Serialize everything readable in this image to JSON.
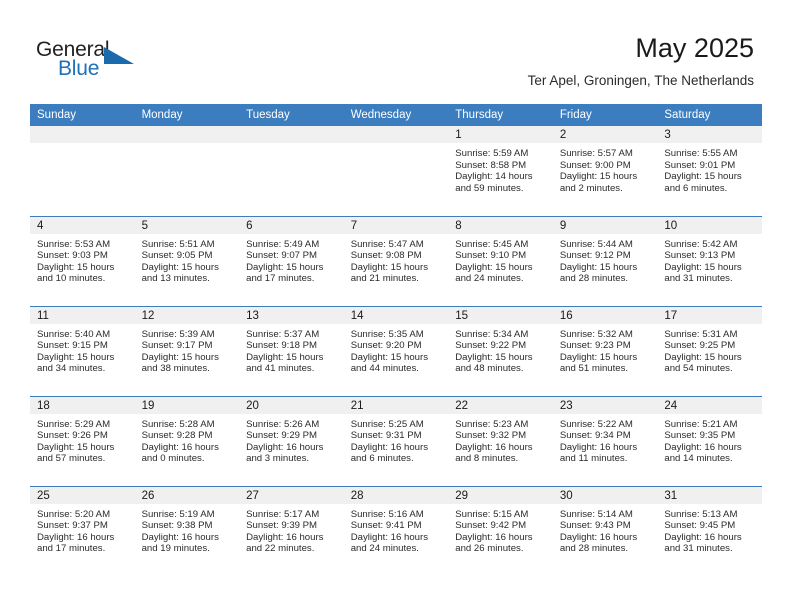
{
  "logo": {
    "word1": "General",
    "word2": "Blue",
    "triangle_color": "#1b6aad",
    "blue_color": "#1d72b8"
  },
  "header": {
    "title": "May 2025",
    "subtitle": "Ter Apel, Groningen, The Netherlands"
  },
  "theme": {
    "header_blue": "#3b7dbf",
    "daynum_bg": "#f0f0f0",
    "text": "#2b2b2b"
  },
  "calendar": {
    "weekday_headers": [
      "Sunday",
      "Monday",
      "Tuesday",
      "Wednesday",
      "Thursday",
      "Friday",
      "Saturday"
    ],
    "weeks": [
      [
        {
          "day": "",
          "sunrise": "",
          "sunset": "",
          "daylight1": "",
          "daylight2": ""
        },
        {
          "day": "",
          "sunrise": "",
          "sunset": "",
          "daylight1": "",
          "daylight2": ""
        },
        {
          "day": "",
          "sunrise": "",
          "sunset": "",
          "daylight1": "",
          "daylight2": ""
        },
        {
          "day": "",
          "sunrise": "",
          "sunset": "",
          "daylight1": "",
          "daylight2": ""
        },
        {
          "day": "1",
          "sunrise": "Sunrise: 5:59 AM",
          "sunset": "Sunset: 8:58 PM",
          "daylight1": "Daylight: 14 hours",
          "daylight2": "and 59 minutes."
        },
        {
          "day": "2",
          "sunrise": "Sunrise: 5:57 AM",
          "sunset": "Sunset: 9:00 PM",
          "daylight1": "Daylight: 15 hours",
          "daylight2": "and 2 minutes."
        },
        {
          "day": "3",
          "sunrise": "Sunrise: 5:55 AM",
          "sunset": "Sunset: 9:01 PM",
          "daylight1": "Daylight: 15 hours",
          "daylight2": "and 6 minutes."
        }
      ],
      [
        {
          "day": "4",
          "sunrise": "Sunrise: 5:53 AM",
          "sunset": "Sunset: 9:03 PM",
          "daylight1": "Daylight: 15 hours",
          "daylight2": "and 10 minutes."
        },
        {
          "day": "5",
          "sunrise": "Sunrise: 5:51 AM",
          "sunset": "Sunset: 9:05 PM",
          "daylight1": "Daylight: 15 hours",
          "daylight2": "and 13 minutes."
        },
        {
          "day": "6",
          "sunrise": "Sunrise: 5:49 AM",
          "sunset": "Sunset: 9:07 PM",
          "daylight1": "Daylight: 15 hours",
          "daylight2": "and 17 minutes."
        },
        {
          "day": "7",
          "sunrise": "Sunrise: 5:47 AM",
          "sunset": "Sunset: 9:08 PM",
          "daylight1": "Daylight: 15 hours",
          "daylight2": "and 21 minutes."
        },
        {
          "day": "8",
          "sunrise": "Sunrise: 5:45 AM",
          "sunset": "Sunset: 9:10 PM",
          "daylight1": "Daylight: 15 hours",
          "daylight2": "and 24 minutes."
        },
        {
          "day": "9",
          "sunrise": "Sunrise: 5:44 AM",
          "sunset": "Sunset: 9:12 PM",
          "daylight1": "Daylight: 15 hours",
          "daylight2": "and 28 minutes."
        },
        {
          "day": "10",
          "sunrise": "Sunrise: 5:42 AM",
          "sunset": "Sunset: 9:13 PM",
          "daylight1": "Daylight: 15 hours",
          "daylight2": "and 31 minutes."
        }
      ],
      [
        {
          "day": "11",
          "sunrise": "Sunrise: 5:40 AM",
          "sunset": "Sunset: 9:15 PM",
          "daylight1": "Daylight: 15 hours",
          "daylight2": "and 34 minutes."
        },
        {
          "day": "12",
          "sunrise": "Sunrise: 5:39 AM",
          "sunset": "Sunset: 9:17 PM",
          "daylight1": "Daylight: 15 hours",
          "daylight2": "and 38 minutes."
        },
        {
          "day": "13",
          "sunrise": "Sunrise: 5:37 AM",
          "sunset": "Sunset: 9:18 PM",
          "daylight1": "Daylight: 15 hours",
          "daylight2": "and 41 minutes."
        },
        {
          "day": "14",
          "sunrise": "Sunrise: 5:35 AM",
          "sunset": "Sunset: 9:20 PM",
          "daylight1": "Daylight: 15 hours",
          "daylight2": "and 44 minutes."
        },
        {
          "day": "15",
          "sunrise": "Sunrise: 5:34 AM",
          "sunset": "Sunset: 9:22 PM",
          "daylight1": "Daylight: 15 hours",
          "daylight2": "and 48 minutes."
        },
        {
          "day": "16",
          "sunrise": "Sunrise: 5:32 AM",
          "sunset": "Sunset: 9:23 PM",
          "daylight1": "Daylight: 15 hours",
          "daylight2": "and 51 minutes."
        },
        {
          "day": "17",
          "sunrise": "Sunrise: 5:31 AM",
          "sunset": "Sunset: 9:25 PM",
          "daylight1": "Daylight: 15 hours",
          "daylight2": "and 54 minutes."
        }
      ],
      [
        {
          "day": "18",
          "sunrise": "Sunrise: 5:29 AM",
          "sunset": "Sunset: 9:26 PM",
          "daylight1": "Daylight: 15 hours",
          "daylight2": "and 57 minutes."
        },
        {
          "day": "19",
          "sunrise": "Sunrise: 5:28 AM",
          "sunset": "Sunset: 9:28 PM",
          "daylight1": "Daylight: 16 hours",
          "daylight2": "and 0 minutes."
        },
        {
          "day": "20",
          "sunrise": "Sunrise: 5:26 AM",
          "sunset": "Sunset: 9:29 PM",
          "daylight1": "Daylight: 16 hours",
          "daylight2": "and 3 minutes."
        },
        {
          "day": "21",
          "sunrise": "Sunrise: 5:25 AM",
          "sunset": "Sunset: 9:31 PM",
          "daylight1": "Daylight: 16 hours",
          "daylight2": "and 6 minutes."
        },
        {
          "day": "22",
          "sunrise": "Sunrise: 5:23 AM",
          "sunset": "Sunset: 9:32 PM",
          "daylight1": "Daylight: 16 hours",
          "daylight2": "and 8 minutes."
        },
        {
          "day": "23",
          "sunrise": "Sunrise: 5:22 AM",
          "sunset": "Sunset: 9:34 PM",
          "daylight1": "Daylight: 16 hours",
          "daylight2": "and 11 minutes."
        },
        {
          "day": "24",
          "sunrise": "Sunrise: 5:21 AM",
          "sunset": "Sunset: 9:35 PM",
          "daylight1": "Daylight: 16 hours",
          "daylight2": "and 14 minutes."
        }
      ],
      [
        {
          "day": "25",
          "sunrise": "Sunrise: 5:20 AM",
          "sunset": "Sunset: 9:37 PM",
          "daylight1": "Daylight: 16 hours",
          "daylight2": "and 17 minutes."
        },
        {
          "day": "26",
          "sunrise": "Sunrise: 5:19 AM",
          "sunset": "Sunset: 9:38 PM",
          "daylight1": "Daylight: 16 hours",
          "daylight2": "and 19 minutes."
        },
        {
          "day": "27",
          "sunrise": "Sunrise: 5:17 AM",
          "sunset": "Sunset: 9:39 PM",
          "daylight1": "Daylight: 16 hours",
          "daylight2": "and 22 minutes."
        },
        {
          "day": "28",
          "sunrise": "Sunrise: 5:16 AM",
          "sunset": "Sunset: 9:41 PM",
          "daylight1": "Daylight: 16 hours",
          "daylight2": "and 24 minutes."
        },
        {
          "day": "29",
          "sunrise": "Sunrise: 5:15 AM",
          "sunset": "Sunset: 9:42 PM",
          "daylight1": "Daylight: 16 hours",
          "daylight2": "and 26 minutes."
        },
        {
          "day": "30",
          "sunrise": "Sunrise: 5:14 AM",
          "sunset": "Sunset: 9:43 PM",
          "daylight1": "Daylight: 16 hours",
          "daylight2": "and 28 minutes."
        },
        {
          "day": "31",
          "sunrise": "Sunrise: 5:13 AM",
          "sunset": "Sunset: 9:45 PM",
          "daylight1": "Daylight: 16 hours",
          "daylight2": "and 31 minutes."
        }
      ]
    ]
  }
}
